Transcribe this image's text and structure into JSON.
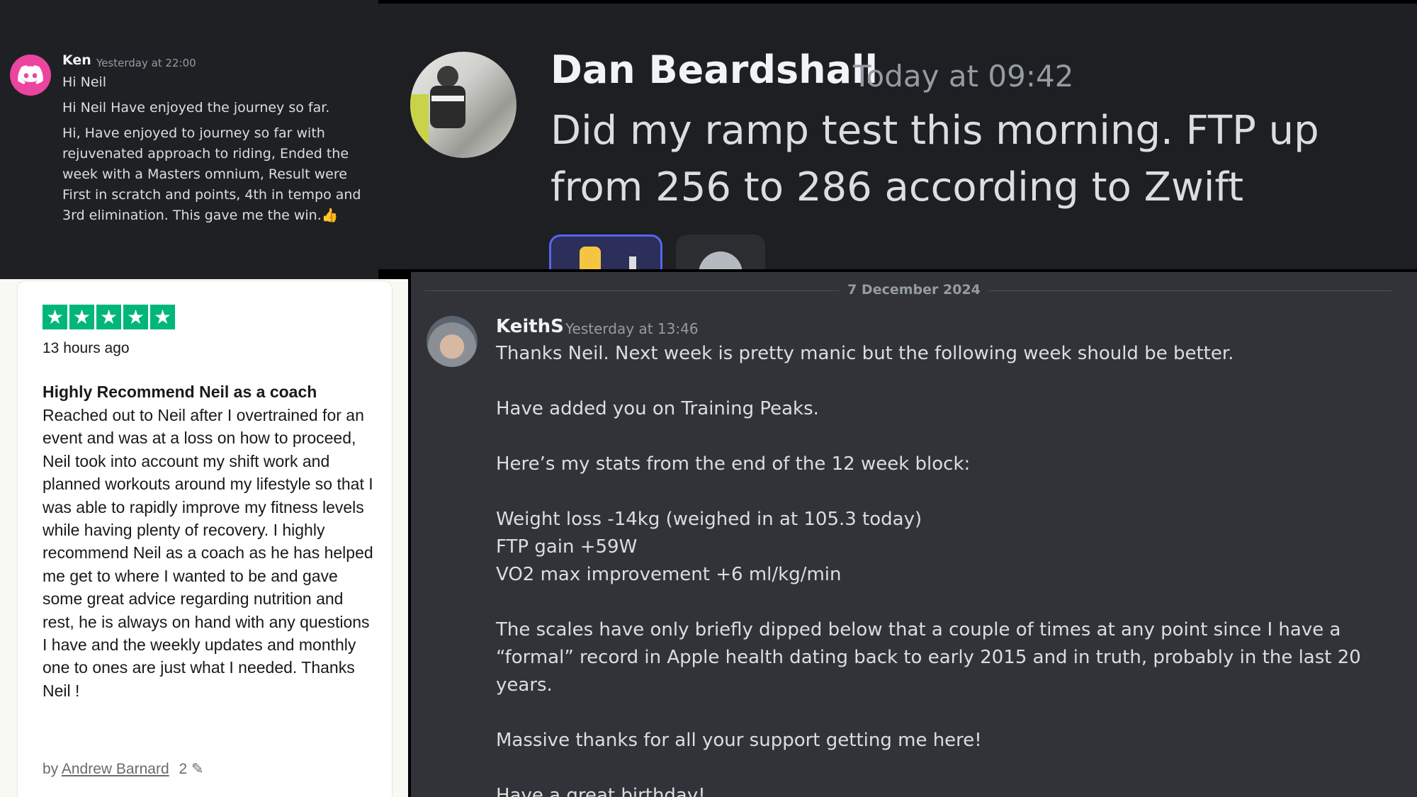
{
  "panel_ken": {
    "name": "Ken",
    "timestamp": "Yesterday at 22:00",
    "messages": [
      "Hi Neil",
      "Hi Neil Have enjoyed the journey so far.",
      "Hi, Have enjoyed to journey so far with rejuvenated approach to riding, Ended the week with a Masters omnium, Result were First in scratch and points, 4th in tempo and 3rd elimination. This gave me the  win.👍"
    ]
  },
  "panel_dan": {
    "name": "Dan Beardshall",
    "timestamp": "Today at 09:42",
    "message": "Did my ramp test this morning. FTP up from 256 to 286 according to Zwift"
  },
  "panel_review": {
    "rating": 5,
    "star_color": "#00b67a",
    "time_ago": "13 hours ago",
    "title": "Highly Recommend Neil as a coach",
    "body": "Reached out to Neil after I overtrained for an event and was at a loss on how to proceed, Neil took into account my shift work and planned workouts around my lifestyle so that I was able to rapidly improve my fitness levels while having plenty of recovery. I highly recommend Neil as a coach as he has helped me get to where I wanted to be and gave some great advice regarding nutrition and rest, he is always on hand with any questions I have and the weekly updates and monthly one to ones are just what I needed. Thanks Neil !",
    "by_label": "by",
    "author": "Andrew Barnard",
    "review_count": "2"
  },
  "panel_keith": {
    "date_divider": "7 December 2024",
    "name": "KeithS",
    "timestamp": "Yesterday at 13:46",
    "lines": {
      "l1": "Thanks Neil.  Next week is pretty manic but the following week should be better.",
      "l2": "Have added you on Training Peaks.",
      "l3": "Here’s my stats from the end of the 12 week block:",
      "l4": "Weight loss -14kg (weighed in at 105.3 today)",
      "l5": "FTP gain +59W",
      "l6": "VO2 max improvement +6 ml/kg/min",
      "l7": "The scales have only briefly dipped below that a couple of times at any point since I have a “formal” record in Apple health dating back to early 2015 and in truth, probably in the last 20 years.",
      "l8": "Massive thanks for all your support getting me here!",
      "l9": "Have a great birthday!"
    }
  }
}
